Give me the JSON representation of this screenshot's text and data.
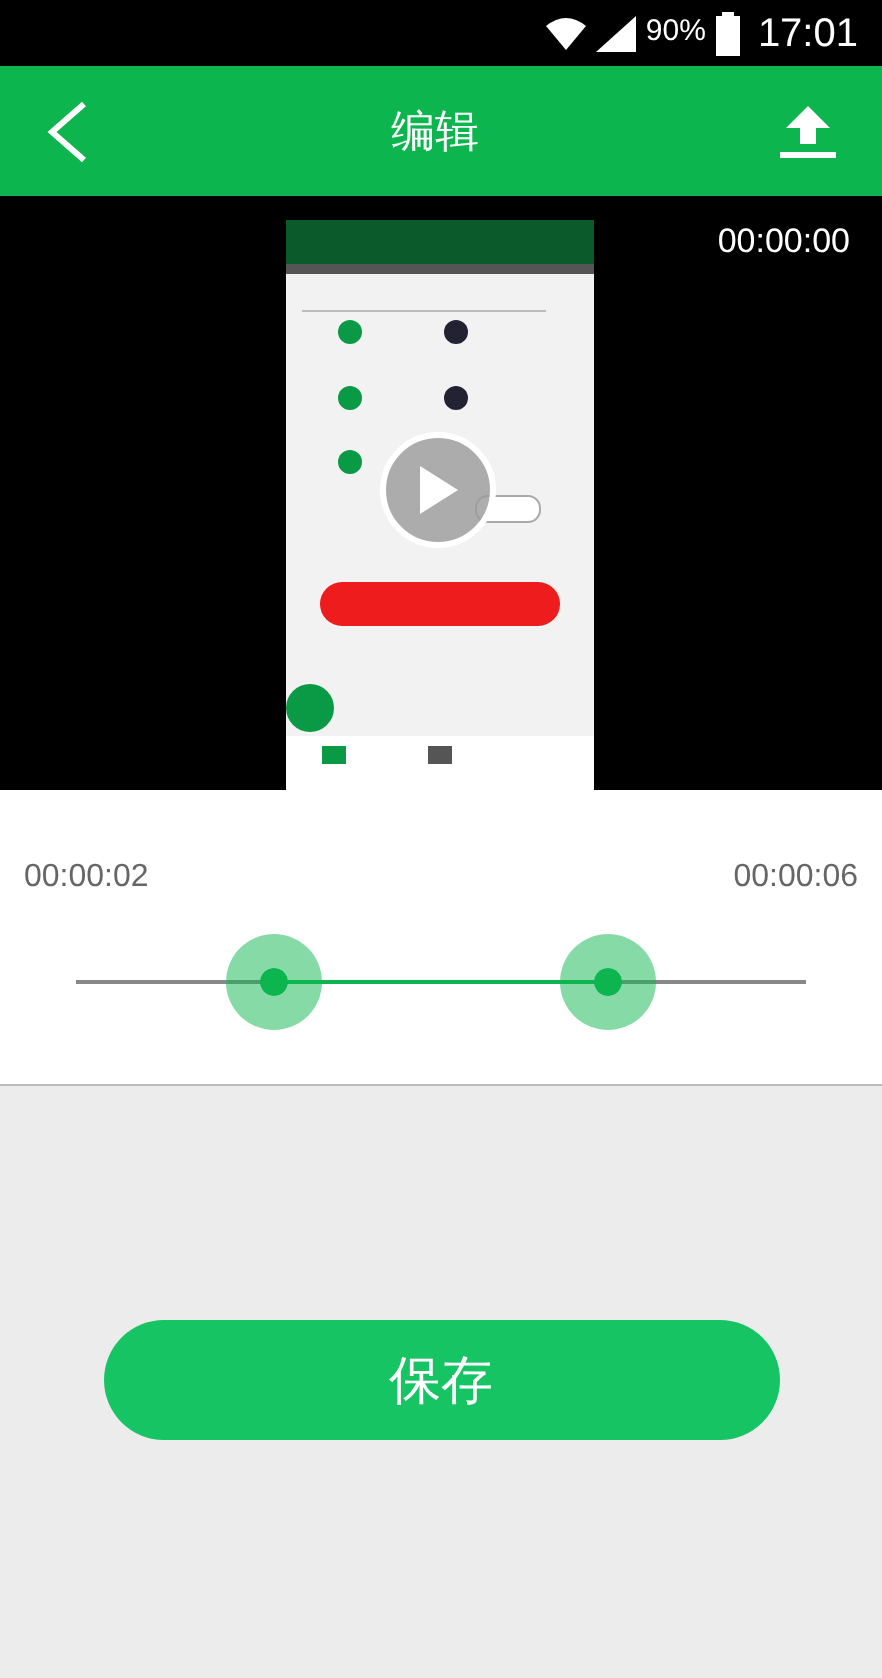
{
  "status_bar": {
    "battery": "90%",
    "time": "17:01"
  },
  "header": {
    "title": "编辑"
  },
  "video": {
    "kind": "picture",
    "timestamp": "00:00:00"
  },
  "trim": {
    "start_time": "00:00:02",
    "end_time": "00:00:06",
    "handles": [
      {
        "level": 0.27
      },
      {
        "level": 0.73
      }
    ]
  },
  "save_button": {
    "label": "保存"
  }
}
